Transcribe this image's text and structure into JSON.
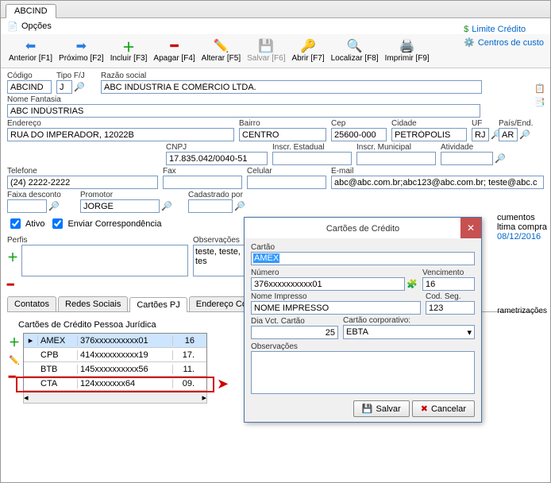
{
  "header": {
    "tab": "ABCIND",
    "menu_opcoes": "Opções"
  },
  "toolbar": {
    "anterior": "Anterior [F1]",
    "proximo": "Próximo [F2]",
    "incluir": "Incluir [F3]",
    "apagar": "Apagar [F4]",
    "alterar": "Alterar [F5]",
    "salvar": "Salvar [F6]",
    "abrir": "Abrir [F7]",
    "localizar": "Localizar [F8]",
    "imprimir": "Imprimir [F9]",
    "limite": "Limite Crédito",
    "centros": "Centros de custo"
  },
  "labels": {
    "codigo": "Código",
    "tipo": "Tipo F/J",
    "razao": "Razão social",
    "nome_fantasia": "Nome Fantasia",
    "endereco": "Endereço",
    "bairro": "Bairro",
    "cep": "Cep",
    "cidade": "Cidade",
    "uf": "UF",
    "pais": "País/End.",
    "cnpj": "CNPJ",
    "inscr_est": "Inscr. Estadual",
    "inscr_mun": "Inscr. Municipal",
    "atividade": "Atividade",
    "telefone": "Telefone",
    "fax": "Fax",
    "celular": "Celular",
    "email": "E-mail",
    "faixa": "Faixa desconto",
    "promotor": "Promotor",
    "cadastrado": "Cadastrado por",
    "ativo": "Ativo",
    "enviar": "Enviar Correspondência",
    "perfis": "Perfis",
    "obs": "Observações",
    "cumentos": "cumentos",
    "ultima_compra": "ltima compra",
    "rametrizacoes": "rametrizações"
  },
  "values": {
    "codigo": "ABCIND",
    "tipo": "J",
    "razao": "ABC INDÚSTRIA E COMÉRCIO LTDA.",
    "nome_fantasia": "ABC INDÚSTRIAS",
    "endereco": "RUA DO IMPERADOR, 12022B",
    "bairro": "CENTRO",
    "cep": "25600-000",
    "cidade": "PETRÓPOLIS",
    "uf": "RJ",
    "pais": "AR",
    "cnpj": "17.835.042/0040-51",
    "inscr_est": "",
    "inscr_mun": "",
    "atividade": "",
    "telefone": "(24) 2222-2222",
    "fax": "",
    "celular": "",
    "email": "abc@abc.com.br;abc123@abc.com.br; teste@abc.c",
    "faixa": "",
    "promotor": "JORGE",
    "cadastrado": "",
    "obs": "teste, teste, tes",
    "ultima_compra": "08/12/2016"
  },
  "tabs2": {
    "contatos": "Contatos",
    "redes": "Redes Sociais",
    "cartoes": "Cartões PJ",
    "endereco_cob": "Endereço Cobrança"
  },
  "grid": {
    "title": "Cartões de Crédito Pessoa Jurídica",
    "rows": [
      {
        "brand": "AMEX",
        "num": "376xxxxxxxxxx01",
        "day": "16"
      },
      {
        "brand": "CPB",
        "num": "414xxxxxxxxxx19",
        "day": "17."
      },
      {
        "brand": "BTB",
        "num": "145xxxxxxxxxx56",
        "day": "11."
      },
      {
        "brand": "CTA",
        "num": "124xxxxxxx64",
        "day": "09."
      }
    ]
  },
  "modal": {
    "title": "Cartões de Crédito",
    "cartao_label": "Cartão",
    "cartao_value": "AMEX",
    "numero_label": "Número",
    "numero_value": "376xxxxxxxxxx01",
    "venc_label": "Vencimento",
    "venc_value": "16",
    "nome_label": "Nome Impresso",
    "nome_value": "NOME IMPRESSO",
    "cod_label": "Cod. Seg.",
    "cod_value": "123",
    "dia_label": "Dia Vct. Cartão",
    "dia_value": "25",
    "corp_label": "Cartão corporativo:",
    "corp_value": "EBTA",
    "obs_label": "Observações",
    "salvar": "Salvar",
    "cancelar": "Cancelar"
  }
}
